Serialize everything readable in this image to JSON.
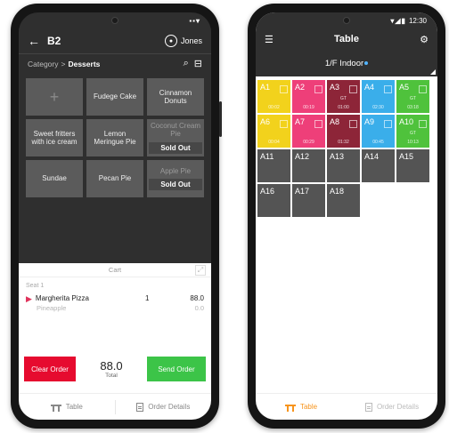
{
  "left_phone": {
    "header": {
      "back_icon": "arrow-left-icon",
      "table_name": "B2",
      "user_icon": "user-circle-icon",
      "user_name": "Jones"
    },
    "breadcrumb": {
      "root": "Category",
      "separator": ">",
      "current": "Desserts",
      "search_icon": "search-icon",
      "filter_icon": "filter-icon"
    },
    "menu_items": [
      {
        "label": "+",
        "type": "add"
      },
      {
        "label": "Fudege Cake",
        "type": "item"
      },
      {
        "label": "Cinnamon Donuts",
        "type": "item"
      },
      {
        "label": "Sweet fritters with ice cream",
        "type": "item"
      },
      {
        "label": "Lemon Meringue Pie",
        "type": "item"
      },
      {
        "label": "Coconut Cream Pie",
        "type": "out",
        "sold_out": "Sold Out"
      },
      {
        "label": "Sundae",
        "type": "item"
      },
      {
        "label": "Pecan Pie",
        "type": "item"
      },
      {
        "label": "Apple Pie",
        "type": "out",
        "sold_out": "Sold Out"
      }
    ],
    "cart": {
      "title": "Cart",
      "expand_icon": "expand-icon",
      "seat": "Seat 1",
      "item_name": "Margherita Pizza",
      "item_qty": "1",
      "item_price": "88.0",
      "modifier": "Pineapple",
      "modifier_price": "0.0",
      "clear_label": "Clear Order",
      "total_amount": "88.0",
      "total_label": "Total",
      "send_label": "Send Order"
    },
    "nav": {
      "table_label": "Table",
      "details_label": "Order Details"
    }
  },
  "right_phone": {
    "status_time": "12:30",
    "header": {
      "menu_icon": "hamburger-icon",
      "title": "Table",
      "gear_icon": "gear-icon"
    },
    "floor": "1/F Indoor",
    "tables": [
      {
        "id": "A1",
        "color": "yellow",
        "time": "00:02"
      },
      {
        "id": "A2",
        "color": "pink",
        "time": "00:19"
      },
      {
        "id": "A3",
        "color": "maroon",
        "time": "01:00",
        "sub": "GT"
      },
      {
        "id": "A4",
        "color": "blue",
        "time": "02:30"
      },
      {
        "id": "A5",
        "color": "green",
        "time": "03:18",
        "sub": "GT"
      },
      {
        "id": "A6",
        "color": "yellow",
        "time": "00:04"
      },
      {
        "id": "A7",
        "color": "pink",
        "time": "00:29"
      },
      {
        "id": "A8",
        "color": "maroon",
        "time": "01:32"
      },
      {
        "id": "A9",
        "color": "blue",
        "time": "00:45"
      },
      {
        "id": "A10",
        "color": "green",
        "time": "10:13",
        "sub": "GT"
      },
      {
        "id": "A11",
        "color": "grey"
      },
      {
        "id": "A12",
        "color": "grey"
      },
      {
        "id": "A13",
        "color": "grey"
      },
      {
        "id": "A14",
        "color": "grey"
      },
      {
        "id": "A15",
        "color": "grey"
      },
      {
        "id": "A16",
        "color": "grey"
      },
      {
        "id": "A17",
        "color": "grey"
      },
      {
        "id": "A18",
        "color": "grey"
      }
    ],
    "nav": {
      "table_label": "Table",
      "details_label": "Order Details"
    }
  },
  "colors": {
    "accent_orange": "#f7941d",
    "clear_red": "#e60b2f",
    "send_green": "#3cc448"
  }
}
